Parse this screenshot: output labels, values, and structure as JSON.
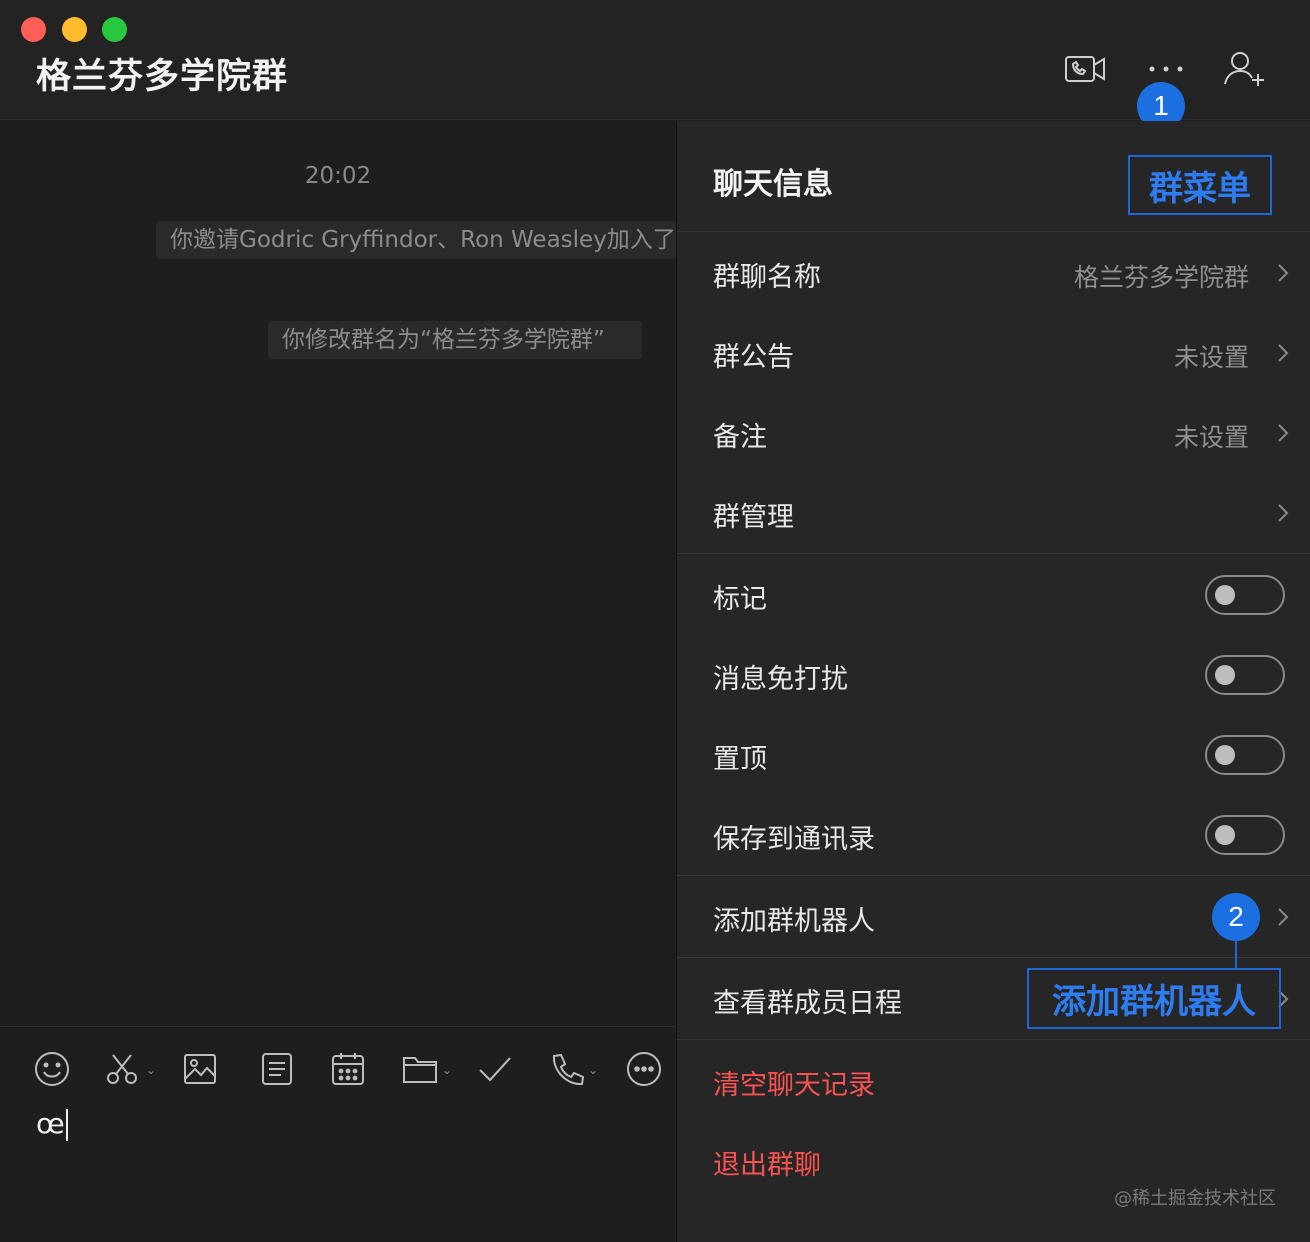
{
  "window": {
    "title": "格兰芬多学院群"
  },
  "toolbar": {
    "video_call_icon": "video-call-icon",
    "more_icon": "more-icon",
    "add_member_icon": "add-member-icon"
  },
  "chat": {
    "time": "20:02",
    "messages": [
      "你邀请Godric Gryffindor、Ron Weasley加入了群聊",
      "你修改群名为“格兰芬多学院群”"
    ]
  },
  "composer": {
    "tools": [
      "emoji-icon",
      "scissors-icon",
      "image-icon",
      "note-icon",
      "calendar-icon",
      "folder-icon",
      "check-icon",
      "phone-icon",
      "more-circle-icon"
    ],
    "input_value": "œ"
  },
  "panel": {
    "title": "聊天信息",
    "rows": [
      {
        "label": "群聊名称",
        "value": "格兰芬多学院群"
      },
      {
        "label": "群公告",
        "value": "未设置"
      },
      {
        "label": "备注",
        "value": "未设置"
      },
      {
        "label": "群管理",
        "value": ""
      }
    ],
    "toggles": [
      {
        "label": "标记",
        "on": false
      },
      {
        "label": "消息免打扰",
        "on": false
      },
      {
        "label": "置顶",
        "on": false
      },
      {
        "label": "保存到通讯录",
        "on": false
      }
    ],
    "actions": [
      {
        "label": "添加群机器人"
      },
      {
        "label": "查看群成员日程"
      }
    ],
    "danger": [
      {
        "label": "清空聊天记录"
      },
      {
        "label": "退出群聊"
      }
    ]
  },
  "annotations": [
    {
      "number": "1",
      "text": "群菜单"
    },
    {
      "number": "2",
      "text": "添加群机器人"
    }
  ],
  "watermark": "@稀土掘金技术社区",
  "colors": {
    "accent": "#1b6fe0",
    "danger": "#fa5151",
    "background": "#1e1e1e",
    "panel": "#262626"
  }
}
